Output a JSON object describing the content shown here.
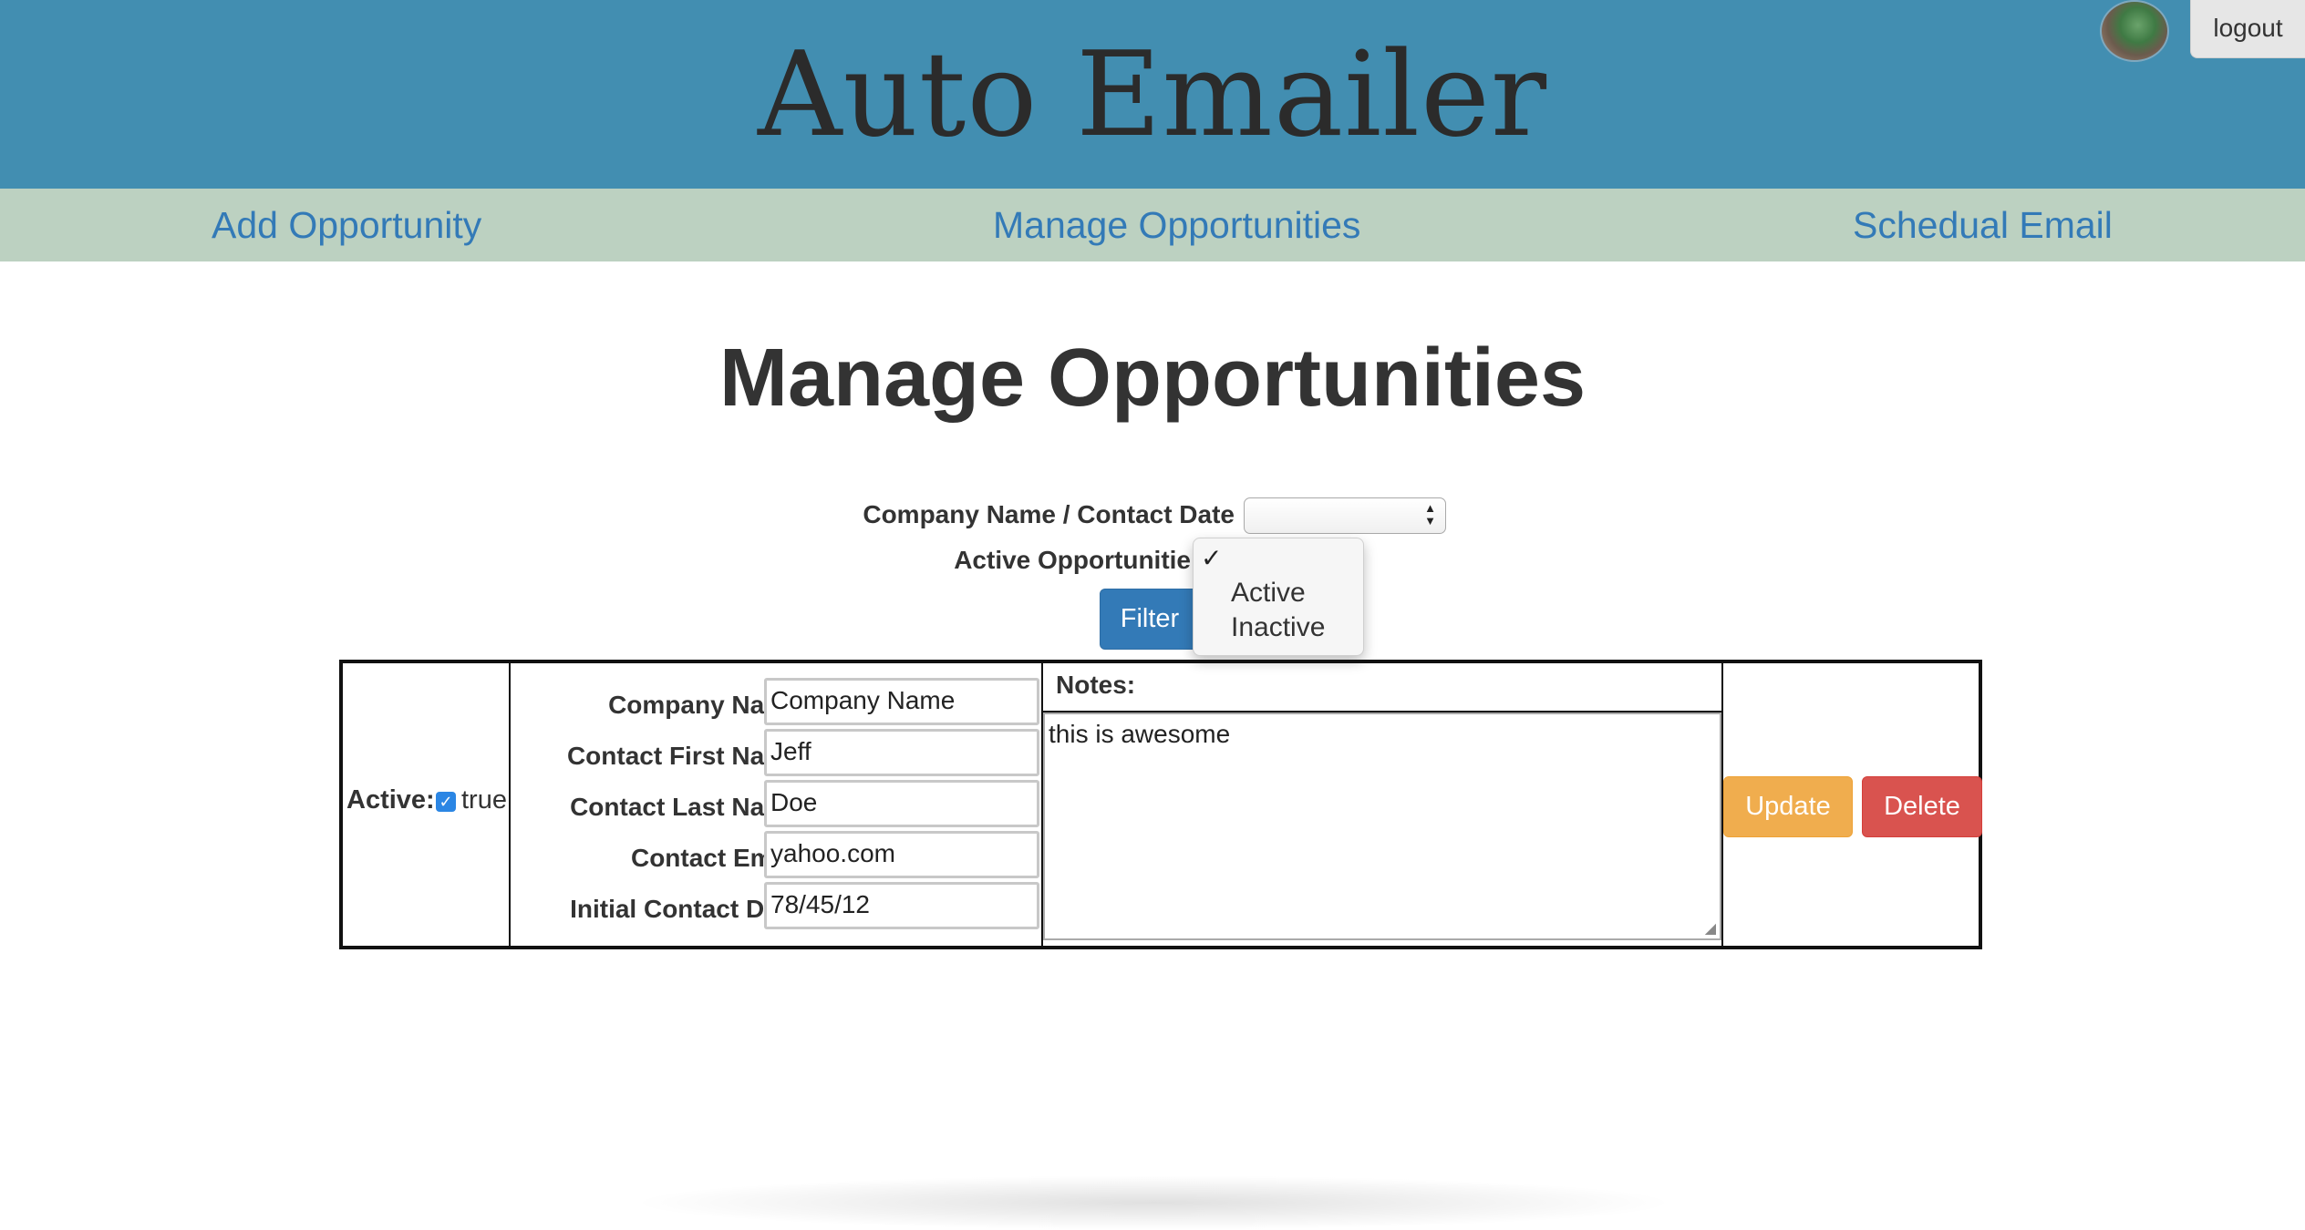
{
  "header": {
    "title": "Auto Emailer",
    "logout_label": "logout",
    "background": "#428eb1"
  },
  "nav": {
    "items": [
      {
        "label": "Add Opportunity"
      },
      {
        "label": "Manage Opportunities"
      },
      {
        "label": "Schedual Email"
      }
    ],
    "background": "#bcd1c1",
    "link_color": "#337ab7"
  },
  "page": {
    "title": "Manage Opportunities"
  },
  "filters": {
    "sort_label": "Company Name / Contact Date",
    "sort_value": "",
    "active_label": "Active Opportunitie",
    "filter_button": "Filter",
    "dropdown": {
      "selected_mark": "✓",
      "options": [
        "Active",
        "Inactive"
      ]
    }
  },
  "record": {
    "active_label": "Active:",
    "active_checked": true,
    "active_value": "true",
    "fields": [
      {
        "label": "Company Name:",
        "value": "Company Name"
      },
      {
        "label": "Contact First Name:",
        "value": "Jeff"
      },
      {
        "label": "Contact Last Name:",
        "value": "Doe"
      },
      {
        "label": "Contact Email:",
        "value": "yahoo.com"
      },
      {
        "label": "Initial Contact Date:",
        "value": "78/45/12"
      }
    ],
    "notes_label": "Notes:",
    "notes_value": "this is awesome",
    "update_label": "Update",
    "delete_label": "Delete"
  },
  "colors": {
    "primary": "#337ab7",
    "warning": "#f0ad4e",
    "danger": "#d9534f"
  }
}
